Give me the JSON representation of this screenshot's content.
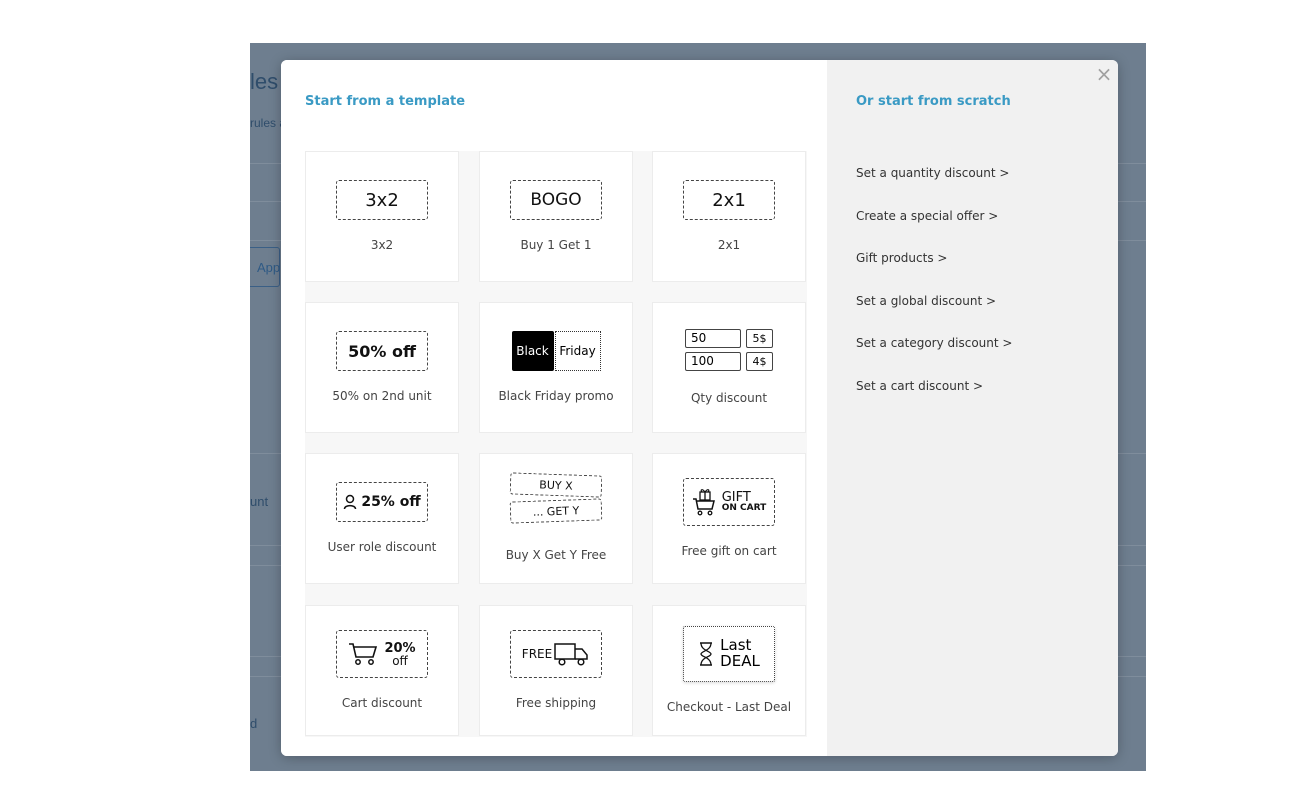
{
  "background": {
    "title_fragment": "les",
    "subtitle_fragment": "rules a",
    "tab_fragment": "App",
    "item1_fragment": "unt",
    "item2_fragment": "d"
  },
  "modal": {
    "close_glyph": "×",
    "left_title": "Start from a template",
    "right_title": "Or start from scratch",
    "templates": [
      {
        "label": "3x2",
        "art": "3x2"
      },
      {
        "label": "Buy 1 Get 1",
        "art": "BOGO"
      },
      {
        "label": "2x1",
        "art": "2x1"
      },
      {
        "label": "50% on 2nd unit",
        "art": "50% off"
      },
      {
        "label": "Black Friday promo",
        "art_left": "Black",
        "art_right": "Friday"
      },
      {
        "label": "Qty discount",
        "qty": [
          {
            "q": "50",
            "p": "5$"
          },
          {
            "q": "100",
            "p": "4$"
          }
        ]
      },
      {
        "label": "User role discount",
        "art": "25% off",
        "icon": "user-icon"
      },
      {
        "label": "Buy X Get Y Free",
        "art_top": "BUY X",
        "art_bottom": "... GET Y"
      },
      {
        "label": "Free gift on cart",
        "art_top": "GIFT",
        "art_bottom": "ON CART",
        "icon": "gift-cart-icon"
      },
      {
        "label": "Cart discount",
        "art_top": "20%",
        "art_bottom": "off",
        "icon": "cart-icon"
      },
      {
        "label": "Free shipping",
        "art": "FREE",
        "icon": "truck-icon"
      },
      {
        "label": "Checkout - Last Deal",
        "art_top": "Last",
        "art_bottom": "DEAL",
        "icon": "hourglass-icon"
      }
    ],
    "scratch_links": [
      "Set a quantity discount >",
      "Create a special offer >",
      "Gift products >",
      "Set a global discount >",
      "Set a category discount >",
      "Set a cart discount >"
    ]
  }
}
